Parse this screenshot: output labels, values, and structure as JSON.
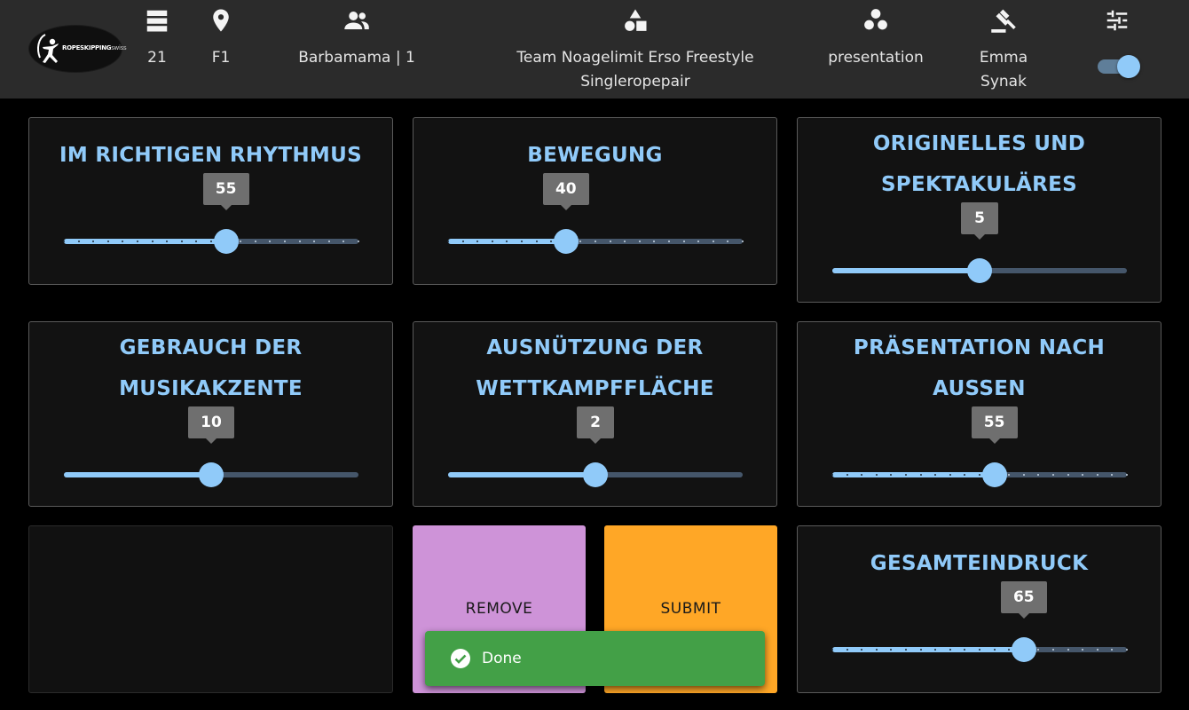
{
  "header": {
    "brand_name": "ROPESKIPPING",
    "brand_suffix": "swiss",
    "heat": "21",
    "field": "F1",
    "participant": "Barbamama | 1",
    "team_line1": "Team Noagelimit Erso Freestyle",
    "team_line2": "Singleropepair",
    "category": "presentation",
    "judge_line1": "Emma",
    "judge_line2": "Synak",
    "toggle_on": true
  },
  "cards": [
    {
      "title_line1": "IM RICHTIGEN RHYTHMUS",
      "title_line2": "",
      "value": 55,
      "max": 100,
      "ticks": 20
    },
    {
      "title_line1": "BEWEGUNG",
      "title_line2": "",
      "value": 40,
      "max": 100,
      "ticks": 20
    },
    {
      "title_line1": "ORIGINELLES UND",
      "title_line2": "SPEKTAKULÄRES",
      "value": 5,
      "max": 10,
      "ticks": 0
    },
    {
      "title_line1": "GEBRAUCH DER",
      "title_line2": "MUSIKAKZENTE",
      "value": 10,
      "max": 20,
      "ticks": 0
    },
    {
      "title_line1": "AUSNÜTZUNG DER",
      "title_line2": "WETTKAMPFFLÄCHE",
      "value": 2,
      "max": 4,
      "ticks": 0
    },
    {
      "title_line1": "PRÄSENTATION NACH",
      "title_line2": "AUSSEN",
      "value": 55,
      "max": 100,
      "ticks": 20
    },
    {
      "title_line1": "GESAMTEINDRUCK",
      "title_line2": "",
      "value": 65,
      "max": 100,
      "ticks": 20
    }
  ],
  "buttons": {
    "remove_label": "REMOVE",
    "submit_label": "SUBMIT"
  },
  "toast": {
    "message": "Done"
  },
  "colors": {
    "accent": "#90caf9",
    "remove": "#ce93d8",
    "submit": "#ffa726",
    "success": "#43a047"
  },
  "icons": [
    "layers-icon",
    "location-pin-icon",
    "people-icon",
    "shapes-icon",
    "bubbles-icon",
    "gavel-icon",
    "tune-icon",
    "check-circle-icon"
  ]
}
